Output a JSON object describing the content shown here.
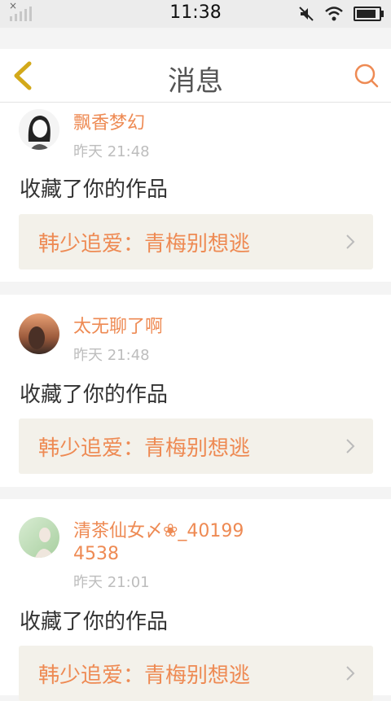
{
  "status_bar": {
    "time": "11:38",
    "battery_level": 0.8
  },
  "header": {
    "title": "消息"
  },
  "messages": [
    {
      "user": "飘香梦幻",
      "time": "昨天 21:48",
      "action": "收藏了你的作品",
      "work_title": "韩少追爱：青梅别想逃"
    },
    {
      "user": "太无聊了啊",
      "time": "昨天 21:48",
      "action": "收藏了你的作品",
      "work_title": "韩少追爱：青梅别想逃"
    },
    {
      "user": "清茶仙女〆❀_401994538",
      "time": "昨天 21:01",
      "action": "收藏了你的作品",
      "work_title": "韩少追爱：青梅别想逃"
    }
  ],
  "colors": {
    "accent": "#ee8a53",
    "back_icon": "#d3a91a",
    "card_link_bg": "#f3f1ea"
  }
}
